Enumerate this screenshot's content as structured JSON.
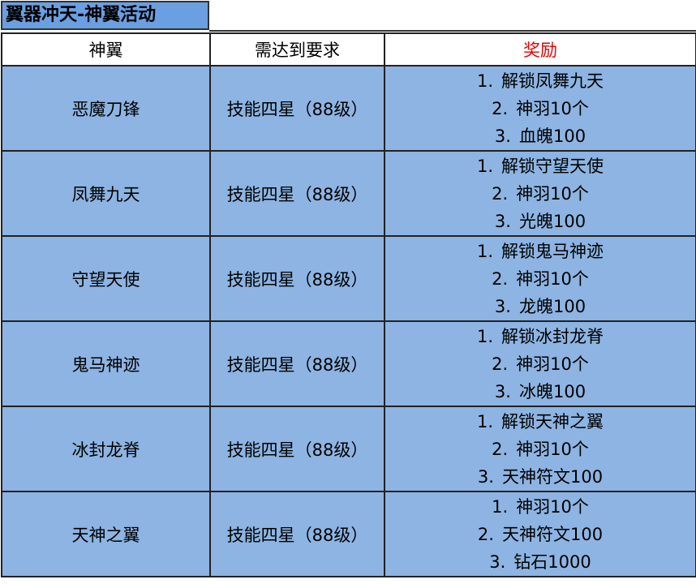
{
  "title": "翼器冲天-神翼活动",
  "headers": {
    "wing": "神翼",
    "requirement": "需达到要求",
    "reward": "奖励"
  },
  "rows": [
    {
      "wing": "恶魔刀锋",
      "requirement": "技能四星（88级）",
      "rewards": [
        {
          "num": "1.",
          "text": "解锁凤舞九天"
        },
        {
          "num": "2.",
          "text": "神羽10个"
        },
        {
          "num": "3.",
          "text": "血魄100"
        }
      ]
    },
    {
      "wing": "凤舞九天",
      "requirement": "技能四星（88级）",
      "rewards": [
        {
          "num": "1.",
          "text": "解锁守望天使"
        },
        {
          "num": "2.",
          "text": "神羽10个"
        },
        {
          "num": "3.",
          "text": "光魄100"
        }
      ]
    },
    {
      "wing": "守望天使",
      "requirement": "技能四星（88级）",
      "rewards": [
        {
          "num": "1.",
          "text": "解锁鬼马神迹"
        },
        {
          "num": "2.",
          "text": "神羽10个"
        },
        {
          "num": "3.",
          "text": "龙魄100"
        }
      ]
    },
    {
      "wing": "鬼马神迹",
      "requirement": "技能四星（88级）",
      "rewards": [
        {
          "num": "1.",
          "text": "解锁冰封龙脊"
        },
        {
          "num": "2.",
          "text": "神羽10个"
        },
        {
          "num": "3.",
          "text": "冰魄100"
        }
      ]
    },
    {
      "wing": "冰封龙脊",
      "requirement": "技能四星（88级）",
      "rewards": [
        {
          "num": "1.",
          "text": "解锁天神之翼"
        },
        {
          "num": "2.",
          "text": "神羽10个"
        },
        {
          "num": "3.",
          "text": "天神符文100"
        }
      ]
    },
    {
      "wing": "天神之翼",
      "requirement": "技能四星（88级）",
      "rewards": [
        {
          "num": "1.",
          "text": "神羽10个"
        },
        {
          "num": "2.",
          "text": "天神符文100"
        },
        {
          "num": "3.",
          "text": "钻石1000"
        }
      ]
    }
  ],
  "colors": {
    "title_bg": "#6a9fe1",
    "row_bg": "#8db4e2",
    "reward_header": "#e60000"
  }
}
